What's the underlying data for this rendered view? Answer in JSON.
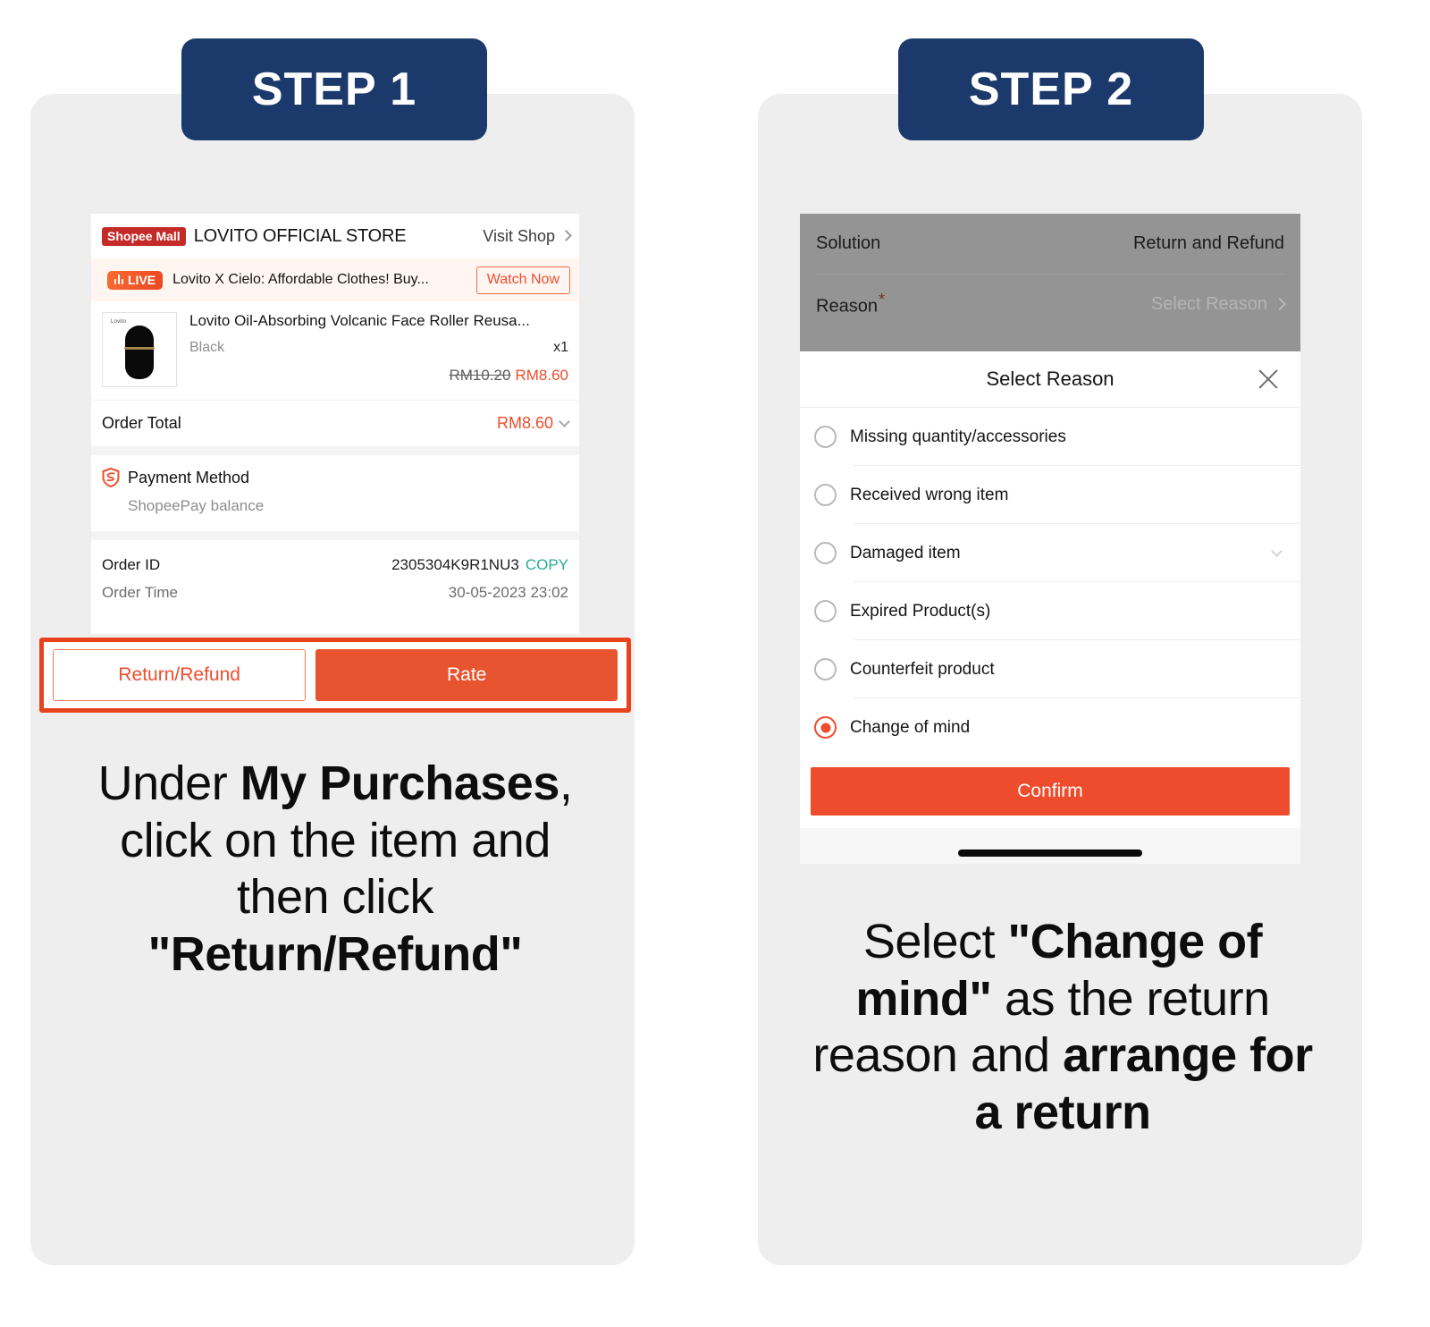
{
  "steps": [
    {
      "badge": "STEP 1"
    },
    {
      "badge": "STEP 2"
    }
  ],
  "colors": {
    "badge_navy": "#1b3a6b",
    "shopee_orange": "#ee4d2d",
    "highlight_red": "#e8431f",
    "mall_red": "#c42a28",
    "copy_green": "#26aa99",
    "panel_grey": "#eeeeee",
    "dim_overlay": "#949494"
  },
  "step1": {
    "shop": {
      "mall_badge": "Shopee Mall",
      "name": "LOVITO OFFICIAL STORE",
      "visit_shop": "Visit Shop",
      "chevron_icon": "chevron-right-icon"
    },
    "live": {
      "badge": "LIVE",
      "title": "Lovito X Cielo: Affordable Clothes! Buy...",
      "watch_button": "Watch Now",
      "live_icon": "live-bars-icon"
    },
    "product": {
      "thumb_logo": "Lovito",
      "name": "Lovito Oil-Absorbing Volcanic Face Roller Reusa...",
      "variant": "Black",
      "quantity": "x1",
      "price_original": "RM10.20",
      "price_final": "RM8.60"
    },
    "order_total": {
      "label": "Order Total",
      "value": "RM8.60",
      "chevron_icon": "chevron-down-icon"
    },
    "payment": {
      "icon": "shield-icon",
      "title": "Payment Method",
      "method": "ShopeePay balance"
    },
    "order_info": {
      "id_label": "Order ID",
      "id_value": "2305304K9R1NU3",
      "copy_label": "COPY",
      "time_label": "Order Time",
      "time_value": "30-05-2023 23:02"
    },
    "actions": {
      "return_refund": "Return/Refund",
      "rate": "Rate"
    }
  },
  "step2": {
    "form": {
      "solution_label": "Solution",
      "solution_value": "Return and Refund",
      "reason_label": "Reason",
      "reason_required_mark": "*",
      "reason_placeholder": "Select Reason",
      "reason_chevron_icon": "chevron-right-icon"
    },
    "sheet": {
      "title": "Select Reason",
      "close_icon": "close-icon",
      "options": [
        {
          "label": "Missing quantity/accessories",
          "selected": false,
          "has_chevron": false
        },
        {
          "label": "Received wrong item",
          "selected": false,
          "has_chevron": false
        },
        {
          "label": "Damaged item",
          "selected": false,
          "has_chevron": true
        },
        {
          "label": "Expired Product(s)",
          "selected": false,
          "has_chevron": false
        },
        {
          "label": "Counterfeit product",
          "selected": false,
          "has_chevron": false
        },
        {
          "label": "Change of mind",
          "selected": true,
          "has_chevron": false
        }
      ],
      "confirm_button": "Confirm"
    }
  },
  "captions": {
    "step1_parts": [
      {
        "text": "Under ",
        "bold": false
      },
      {
        "text": "My Purchases",
        "bold": true
      },
      {
        "text": ", click on the item and then click ",
        "bold": false
      },
      {
        "text": "\"Return/Refund\"",
        "bold": true
      }
    ],
    "step2_parts": [
      {
        "text": "Select ",
        "bold": false
      },
      {
        "text": "\"Change of mind\"",
        "bold": true
      },
      {
        "text": " as the return reason and ",
        "bold": false
      },
      {
        "text": "arrange for a return",
        "bold": true
      }
    ]
  }
}
